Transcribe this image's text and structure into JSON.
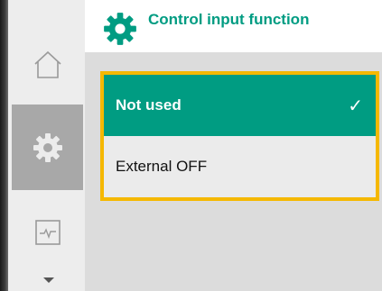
{
  "header": {
    "title": "Control input function",
    "icon": "gear-icon"
  },
  "sidebar": {
    "items": [
      {
        "icon": "home-icon",
        "active": false
      },
      {
        "icon": "gear-icon",
        "active": true
      },
      {
        "icon": "diagnostics-icon",
        "active": false
      }
    ],
    "scroll_icon": "chevron-down-icon"
  },
  "options": [
    {
      "label": "Not used",
      "selected": true,
      "check": "✓"
    },
    {
      "label": "External OFF",
      "selected": false
    }
  ],
  "colors": {
    "accent": "#009c82",
    "focus": "#f5b800",
    "selected_sidebar": "#a8a8a8"
  }
}
